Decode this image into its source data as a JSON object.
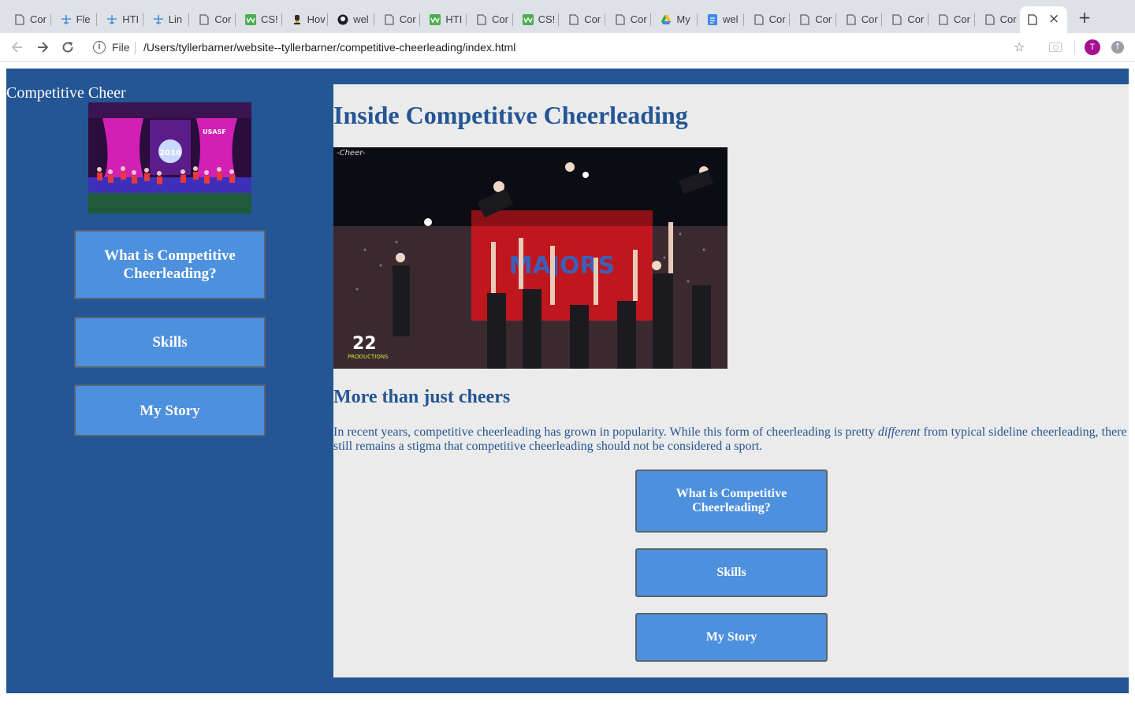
{
  "browser": {
    "tabs": [
      {
        "title": "Cor",
        "icon": "document-icon"
      },
      {
        "title": "Fle",
        "icon": "plane-icon"
      },
      {
        "title": "HTI",
        "icon": "plane-icon"
      },
      {
        "title": "Lin",
        "icon": "plane-icon"
      },
      {
        "title": "Cor",
        "icon": "document-icon"
      },
      {
        "title": "CS!",
        "icon": "w3-icon"
      },
      {
        "title": "Hov",
        "icon": "trophy-icon"
      },
      {
        "title": "wel",
        "icon": "github-icon"
      },
      {
        "title": "Cor",
        "icon": "document-icon"
      },
      {
        "title": "HTI",
        "icon": "w3-icon"
      },
      {
        "title": "Cor",
        "icon": "document-icon"
      },
      {
        "title": "CS!",
        "icon": "w3-icon"
      },
      {
        "title": "Cor",
        "icon": "document-icon"
      },
      {
        "title": "Cor",
        "icon": "document-icon"
      },
      {
        "title": "My",
        "icon": "drive-icon"
      },
      {
        "title": "wel",
        "icon": "docs-icon"
      },
      {
        "title": "Cor",
        "icon": "document-icon"
      },
      {
        "title": "Cor",
        "icon": "document-icon"
      },
      {
        "title": "Cor",
        "icon": "document-icon"
      },
      {
        "title": "Cor",
        "icon": "document-icon"
      },
      {
        "title": "Cor",
        "icon": "document-icon"
      },
      {
        "title": "Cor",
        "icon": "document-icon"
      }
    ],
    "active_tab_close": "×",
    "new_tab": "+",
    "url_scheme": "File",
    "url": "/Users/tyllerbarner/website--tyllerbarner/competitive-cheerleading/index.html",
    "avatar_letter": "T"
  },
  "sidebar": {
    "site_title": "Competitive Cheer",
    "buttons": [
      {
        "label": "What is Competitive Cheerleading?"
      },
      {
        "label": "Skills"
      },
      {
        "label": "My Story"
      }
    ]
  },
  "main": {
    "title": "Inside Competitive Cheerleading",
    "hero_watermark": "-Cheer-",
    "hero_banner": "MAJORS",
    "hero_logo_number": "22",
    "hero_logo_text": "PRODUCTIONS",
    "side_photo_banner": "USASF",
    "side_photo_year": "2016",
    "subtitle": "More than just cheers",
    "intro_before": "In recent years, competitive cheerleading has grown in popularity. While this form of cheerleading is pretty ",
    "intro_emphasis": "different",
    "intro_after": " from typical sideline cheerleading, there still remains a stigma that competitive cheerleading should not be considered a sport.",
    "buttons": [
      {
        "label": "What is Competitive Cheerleading?"
      },
      {
        "label": "Skills"
      },
      {
        "label": "My Story"
      }
    ]
  },
  "colors": {
    "page_background": "#245594",
    "content_background": "#ebebeb",
    "button_fill": "#4d90dd",
    "button_border": "#5b6470",
    "heading_text": "#245594"
  }
}
